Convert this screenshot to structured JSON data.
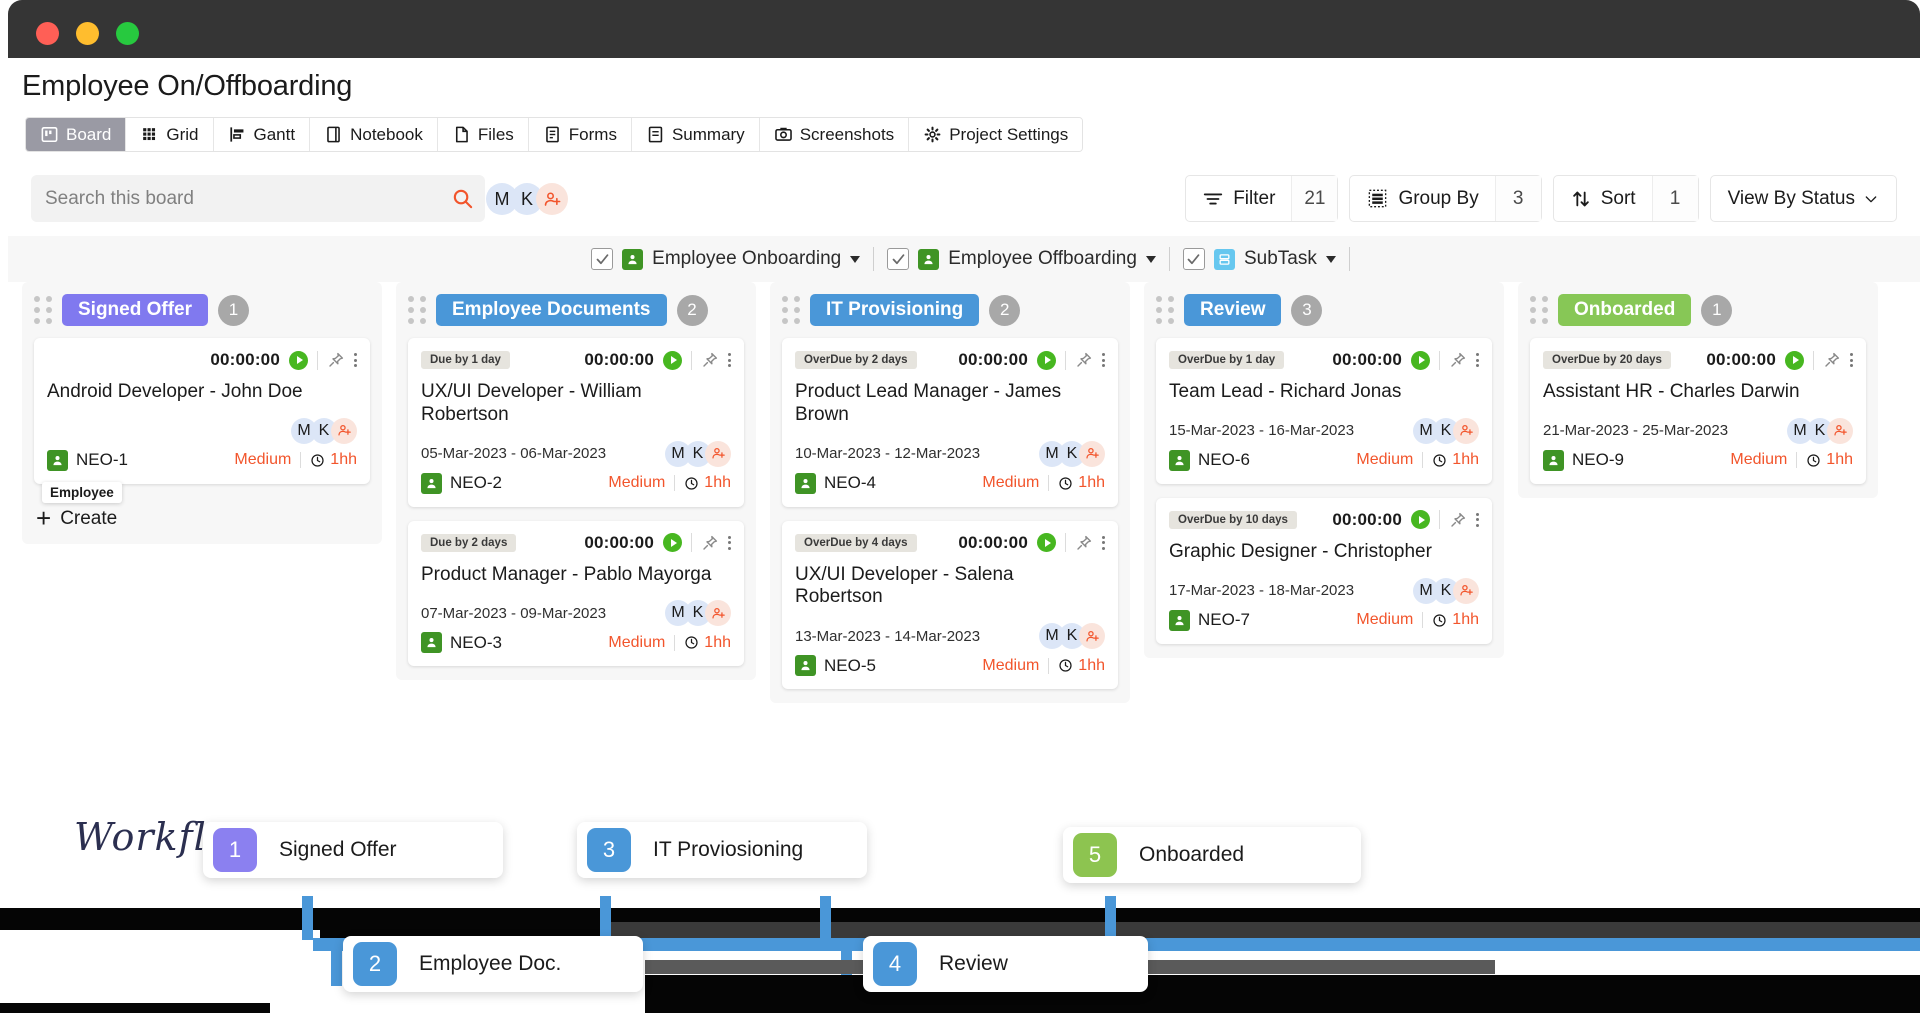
{
  "window": {
    "buttons": [
      "close",
      "minimize",
      "maximize"
    ]
  },
  "header": {
    "title": "Employee On/Offboarding"
  },
  "tabs": [
    {
      "label": "Board",
      "icon": "board-icon",
      "active": true
    },
    {
      "label": "Grid",
      "icon": "grid-icon",
      "active": false
    },
    {
      "label": "Gantt",
      "icon": "gantt-icon",
      "active": false
    },
    {
      "label": "Notebook",
      "icon": "notebook-icon",
      "active": false
    },
    {
      "label": "Files",
      "icon": "file-icon",
      "active": false
    },
    {
      "label": "Forms",
      "icon": "form-icon",
      "active": false
    },
    {
      "label": "Summary",
      "icon": "summary-icon",
      "active": false
    },
    {
      "label": "Screenshots",
      "icon": "camera-icon",
      "active": false
    },
    {
      "label": "Project Settings",
      "icon": "gear-icon",
      "active": false
    }
  ],
  "toolbar": {
    "search_placeholder": "Search this board",
    "search_value": "",
    "search_icon": "search-icon",
    "avatars": [
      "M",
      "K"
    ],
    "add_member_icon": "add-user-icon",
    "filter_label": "Filter",
    "filter_count": "21",
    "group_by_label": "Group By",
    "group_by_count": "3",
    "sort_label": "Sort",
    "sort_count": "1",
    "view_by_label": "View By Status"
  },
  "chips": [
    {
      "label": "Employee Onboarding",
      "checked": true,
      "icon": "user-tag-icon",
      "color": "#3f9425"
    },
    {
      "label": "Employee Offboarding",
      "checked": true,
      "icon": "user-tag-icon",
      "color": "#3f9425"
    },
    {
      "label": "SubTask",
      "checked": true,
      "icon": "subtask-icon",
      "color": "#66c7ef"
    }
  ],
  "board": {
    "create_label": "Create",
    "columns": [
      {
        "title": "Signed Offer",
        "color": "#8079ef",
        "count": "1",
        "show_create": true,
        "cards": [
          {
            "due": "",
            "timer": "00:00:00",
            "title": "Android Developer - John Doe",
            "dates": "",
            "tag": "NEO-1",
            "tooltip": "Employee",
            "avatars": [
              "M",
              "K"
            ],
            "priority": "Medium",
            "estimate": "1hh"
          }
        ]
      },
      {
        "title": "Employee Documents",
        "color": "#4a97d8",
        "count": "2",
        "show_create": false,
        "cards": [
          {
            "due": "Due by 1 day",
            "timer": "00:00:00",
            "title": "UX/UI Developer - William Robertson",
            "dates": "05-Mar-2023 - 06-Mar-2023",
            "tag": "NEO-2",
            "tooltip": "",
            "avatars": [
              "M",
              "K"
            ],
            "priority": "Medium",
            "estimate": "1hh"
          },
          {
            "due": "Due by 2 days",
            "timer": "00:00:00",
            "title": "Product Manager - Pablo Mayorga",
            "dates": "07-Mar-2023 - 09-Mar-2023",
            "tag": "NEO-3",
            "tooltip": "",
            "avatars": [
              "M",
              "K"
            ],
            "priority": "Medium",
            "estimate": "1hh"
          }
        ]
      },
      {
        "title": "IT Provisioning",
        "color": "#4a97d8",
        "count": "2",
        "show_create": false,
        "cards": [
          {
            "due": "OverDue by 2 days",
            "timer": "00:00:00",
            "title": "Product Lead Manager - James Brown",
            "dates": "10-Mar-2023 - 12-Mar-2023",
            "tag": "NEO-4",
            "tooltip": "",
            "avatars": [
              "M",
              "K"
            ],
            "priority": "Medium",
            "estimate": "1hh"
          },
          {
            "due": "OverDue by 4 days",
            "timer": "00:00:00",
            "title": "UX/UI Developer - Salena Robertson",
            "dates": "13-Mar-2023 - 14-Mar-2023",
            "tag": "NEO-5",
            "tooltip": "",
            "avatars": [
              "M",
              "K"
            ],
            "priority": "Medium",
            "estimate": "1hh"
          }
        ]
      },
      {
        "title": "Review",
        "color": "#4a97d8",
        "count": "3",
        "show_create": false,
        "cards": [
          {
            "due": "OverDue by 1 day",
            "timer": "00:00:00",
            "title": "Team Lead - Richard Jonas",
            "dates": "15-Mar-2023 - 16-Mar-2023",
            "tag": "NEO-6",
            "tooltip": "",
            "avatars": [
              "M",
              "K"
            ],
            "priority": "Medium",
            "estimate": "1hh"
          },
          {
            "due": "OverDue by 10 days",
            "timer": "00:00:00",
            "title": "Graphic Designer - Christopher",
            "dates": "17-Mar-2023 - 18-Mar-2023",
            "tag": "NEO-7",
            "tooltip": "",
            "avatars": [
              "M",
              "K"
            ],
            "priority": "Medium",
            "estimate": "1hh"
          }
        ]
      },
      {
        "title": "Onboarded",
        "color": "#87c756",
        "count": "1",
        "show_create": false,
        "cards": [
          {
            "due": "OverDue by 20 days",
            "timer": "00:00:00",
            "title": "Assistant HR - Charles Darwin",
            "dates": "21-Mar-2023 - 25-Mar-2023",
            "tag": "NEO-9",
            "tooltip": "",
            "avatars": [
              "M",
              "K"
            ],
            "priority": "Medium",
            "estimate": "1hh"
          }
        ]
      }
    ]
  },
  "workflow": {
    "title": "Workflow",
    "nodes": [
      {
        "number": "1",
        "label": "Signed Offer",
        "color": "#8b80f0"
      },
      {
        "number": "2",
        "label": "Employee Doc.",
        "color": "#4a97d8"
      },
      {
        "number": "3",
        "label": "IT Proviosioning",
        "color": "#4a97d8"
      },
      {
        "number": "4",
        "label": "Review",
        "color": "#4a97d8"
      },
      {
        "number": "5",
        "label": "Onboarded",
        "color": "#8dc450"
      }
    ]
  }
}
